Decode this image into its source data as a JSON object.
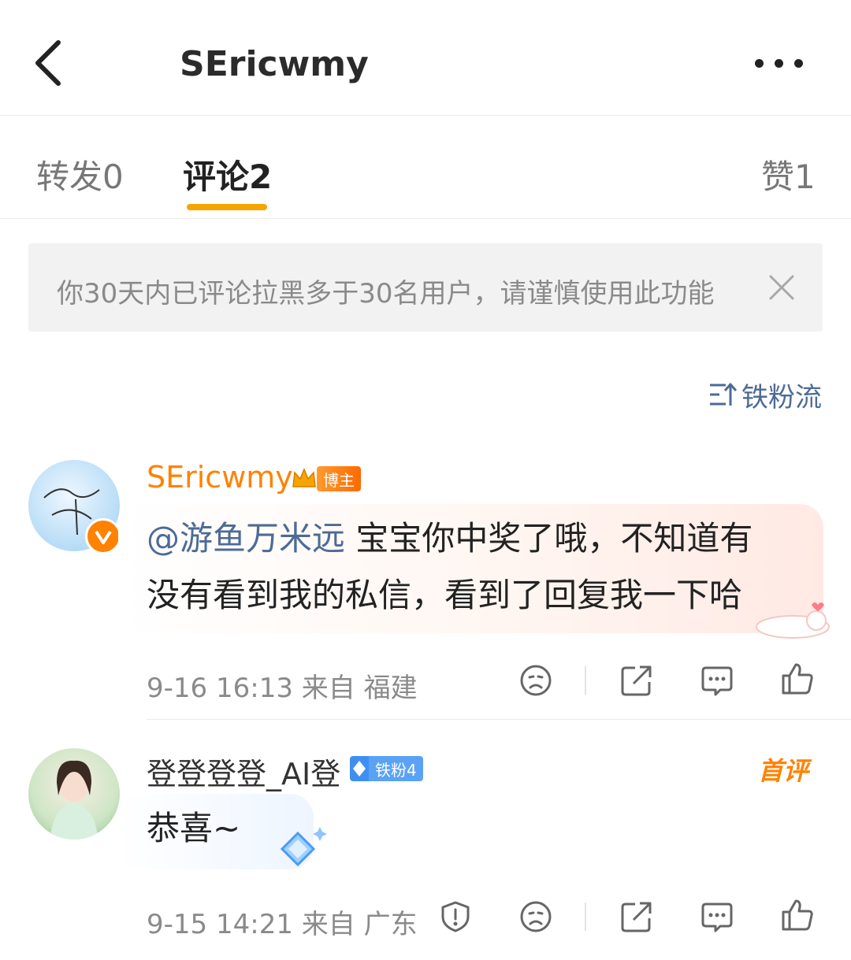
{
  "header": {
    "title": "SEricwmy"
  },
  "tabs": [
    {
      "label": "转发0",
      "active": false
    },
    {
      "label": "评论2",
      "active": true
    },
    {
      "label": "赞1",
      "active": false
    }
  ],
  "notice": {
    "text": "你30天内已评论拉黑多于30名用户，请谨慎使用此功能"
  },
  "sort": {
    "label": "铁粉流"
  },
  "colors": {
    "accent": "#f5a500",
    "link": "#4d6b96",
    "author": "#ff8200"
  },
  "comments": [
    {
      "username": "SEricwmy",
      "badge": "博主",
      "mention": "@游鱼万米远",
      "text_line1": " 宝宝你中奖了哦，不知道有",
      "text_line2": "没有看到我的私信，看到了回复我一下哈",
      "meta": "9-16 16:13  来自 福建",
      "verified": true
    },
    {
      "username": "登登登登_AI登",
      "badge": "铁粉4",
      "tag": "首评",
      "text": "恭喜~",
      "meta": "9-15 14:21  来自 广东"
    }
  ]
}
